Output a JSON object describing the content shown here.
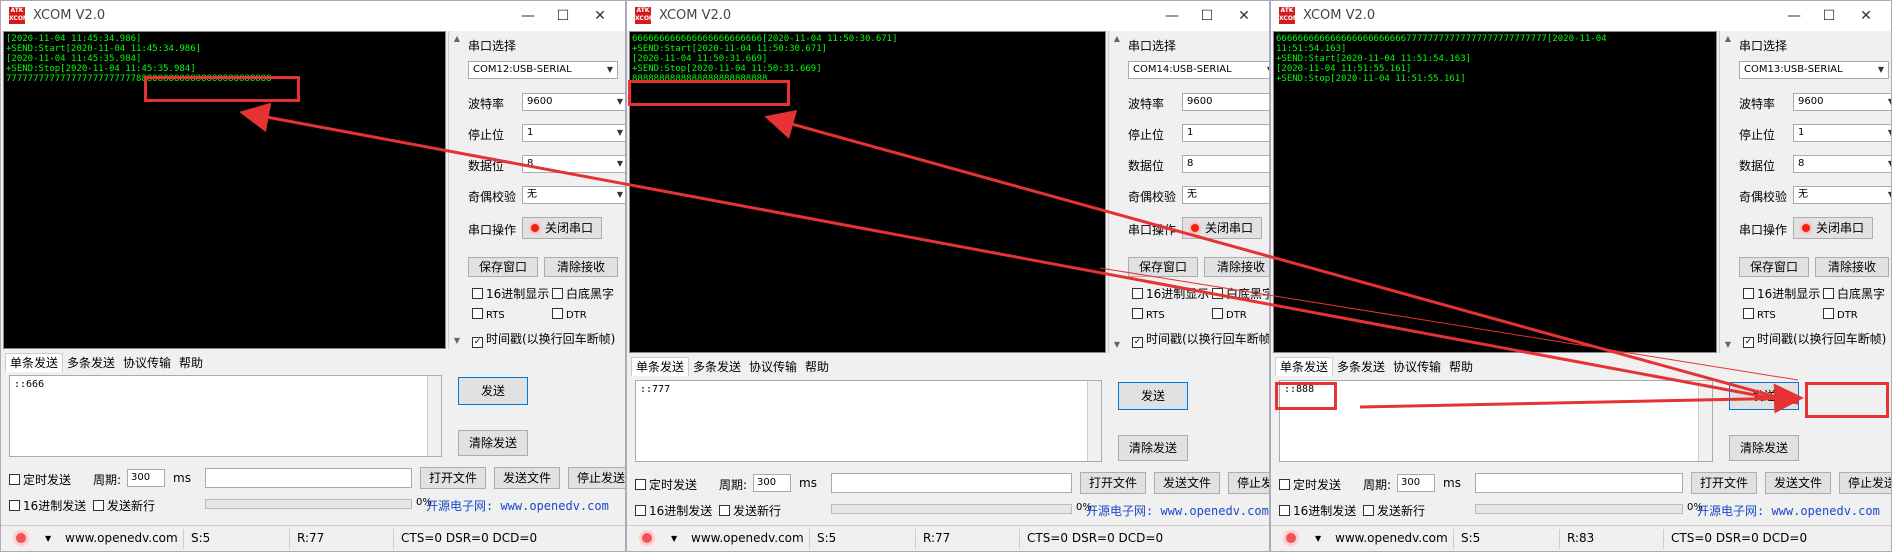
{
  "windows": [
    {
      "title": "XCOM V2.0",
      "logo": "ATK XCOM",
      "terminal": [
        "[2020-11-04 11:45:34.986]",
        "+SEND:Start[2020-11-04 11:45:34.986]",
        "[2020-11-04 11:45:35.984]",
        "+SEND:Stop[2020-11-04 11:45:35.984]",
        "7777777777777777777777778888888888888888888888888"
      ],
      "port_select_label": "串口选择",
      "port": "COM12:USB-SERIAL",
      "baud_label": "波特率",
      "baud": "9600",
      "stop_label": "停止位",
      "stop": "1",
      "data_label": "数据位",
      "data": "8",
      "parity_label": "奇偶校验",
      "parity": "无",
      "op_label": "串口操作",
      "close_btn": "关闭串口",
      "save_btn": "保存窗口",
      "clear_recv_btn": "清除接收",
      "hex_show": "16进制显示",
      "white_bg": "白底黑字",
      "rts": "RTS",
      "dtr": "DTR",
      "timestamp": "时间戳(以换行回车断帧)",
      "tabs": [
        "单条发送",
        "多条发送",
        "协议传输",
        "帮助"
      ],
      "send_text": "::666",
      "send_btn": "发送",
      "clear_send_btn": "清除发送",
      "timed_send": "定时发送",
      "period_label": "周期:",
      "period": "300",
      "ms": "ms",
      "open_file_btn": "打开文件",
      "send_file_btn": "发送文件",
      "stop_send_btn": "停止发送",
      "hex_send": "16进制发送",
      "send_newline": "发送新行",
      "progress": "0%",
      "link": "开源电子网: www.openedv.com",
      "status_url": "www.openedv.com",
      "status_s": "S:5",
      "status_r": "R:77",
      "status_lines": "CTS=0 DSR=0 DCD=0"
    },
    {
      "title": "XCOM V2.0",
      "logo": "ATK XCOM",
      "terminal": [
        "666666666666666666666666[2020-11-04 11:50:30.671]",
        "+SEND:Start[2020-11-04 11:50:30.671]",
        "[2020-11-04 11:50:31.669]",
        "+SEND:Stop[2020-11-04 11:50:31.669]",
        "8888888888888888888888888"
      ],
      "port_select_label": "串口选择",
      "port": "COM14:USB-SERIAL",
      "baud_label": "波特率",
      "baud": "9600",
      "stop_label": "停止位",
      "stop": "1",
      "data_label": "数据位",
      "data": "8",
      "parity_label": "奇偶校验",
      "parity": "无",
      "op_label": "串口操作",
      "close_btn": "关闭串口",
      "save_btn": "保存窗口",
      "clear_recv_btn": "清除接收",
      "hex_show": "16进制显示",
      "white_bg": "白底黑字",
      "rts": "RTS",
      "dtr": "DTR",
      "timestamp": "时间戳(以换行回车断帧)",
      "tabs": [
        "单条发送",
        "多条发送",
        "协议传输",
        "帮助"
      ],
      "send_text": "::777",
      "send_btn": "发送",
      "clear_send_btn": "清除发送",
      "timed_send": "定时发送",
      "period_label": "周期:",
      "period": "300",
      "ms": "ms",
      "open_file_btn": "打开文件",
      "send_file_btn": "发送文件",
      "stop_send_btn": "停止发送",
      "hex_send": "16进制发送",
      "send_newline": "发送新行",
      "progress": "0%",
      "link": "开源电子网: www.openedv.com",
      "status_url": "www.openedv.com",
      "status_s": "S:5",
      "status_r": "R:77",
      "status_lines": "CTS=0 DSR=0 DCD=0"
    },
    {
      "title": "XCOM V2.0",
      "logo": "ATK XCOM",
      "terminal": [
        "66666666666666666666666677777777777777777777777777[2020-11-04",
        "11:51:54.163]",
        "+SEND:Start[2020-11-04 11:51:54.163]",
        "[2020-11-04 11:51:55.161]",
        "+SEND:Stop[2020-11-04 11:51:55.161]"
      ],
      "port_select_label": "串口选择",
      "port": "COM13:USB-SERIAL",
      "baud_label": "波特率",
      "baud": "9600",
      "stop_label": "停止位",
      "stop": "1",
      "data_label": "数据位",
      "data": "8",
      "parity_label": "奇偶校验",
      "parity": "无",
      "op_label": "串口操作",
      "close_btn": "关闭串口",
      "save_btn": "保存窗口",
      "clear_recv_btn": "清除接收",
      "hex_show": "16进制显示",
      "white_bg": "白底黑字",
      "rts": "RTS",
      "dtr": "DTR",
      "timestamp": "时间戳(以换行回车断帧)",
      "tabs": [
        "单条发送",
        "多条发送",
        "协议传输",
        "帮助"
      ],
      "send_text": "::888",
      "send_btn": "发送",
      "clear_send_btn": "清除发送",
      "timed_send": "定时发送",
      "period_label": "周期:",
      "period": "300",
      "ms": "ms",
      "open_file_btn": "打开文件",
      "send_file_btn": "发送文件",
      "stop_send_btn": "停止发送",
      "hex_send": "16进制发送",
      "send_newline": "发送新行",
      "progress": "0%",
      "link": "开源电子网: www.openedv.com",
      "status_url": "www.openedv.com",
      "status_s": "S:5",
      "status_r": "R:83",
      "status_lines": "CTS=0 DSR=0 DCD=0"
    }
  ],
  "colors": {
    "terminal_bg": "#000000",
    "terminal_text": "#00ff00",
    "annotation_red": "#e53333",
    "link_blue": "#1c49cc"
  }
}
